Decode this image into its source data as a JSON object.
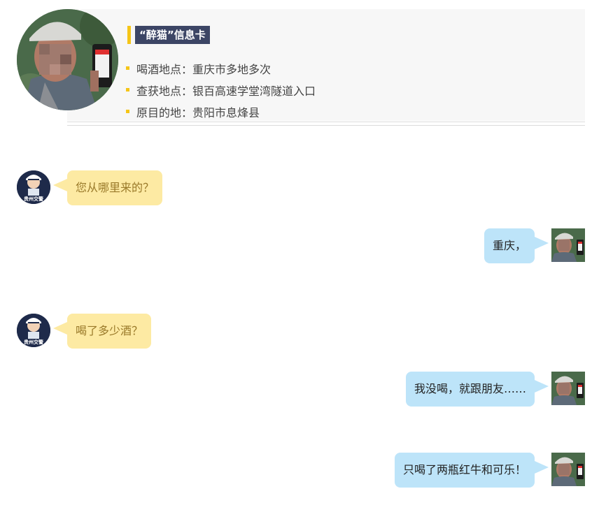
{
  "info_card": {
    "title": "“醉猫”信息卡",
    "items": [
      "喝酒地点：重庆市多地多次",
      "查获地点：银百高速学堂湾隧道入口",
      "原目的地：贵阳市息烽县"
    ]
  },
  "avatars": {
    "police_badge_text": "贵州交警"
  },
  "chat": [
    {
      "speaker": "police",
      "text": "您从哪里来的？"
    },
    {
      "speaker": "suspect",
      "text": "重庆，"
    },
    {
      "speaker": "police",
      "text": "喝了多少酒？"
    },
    {
      "speaker": "suspect",
      "text": "我没喝，就跟朋友……"
    },
    {
      "speaker": "suspect",
      "text": "只喝了两瓶红牛和可乐！"
    }
  ],
  "colors": {
    "accent_yellow": "#f5c518",
    "title_bg": "#3c4565",
    "police_bubble": "#fdeaa3",
    "suspect_bubble": "#bde4f9"
  }
}
